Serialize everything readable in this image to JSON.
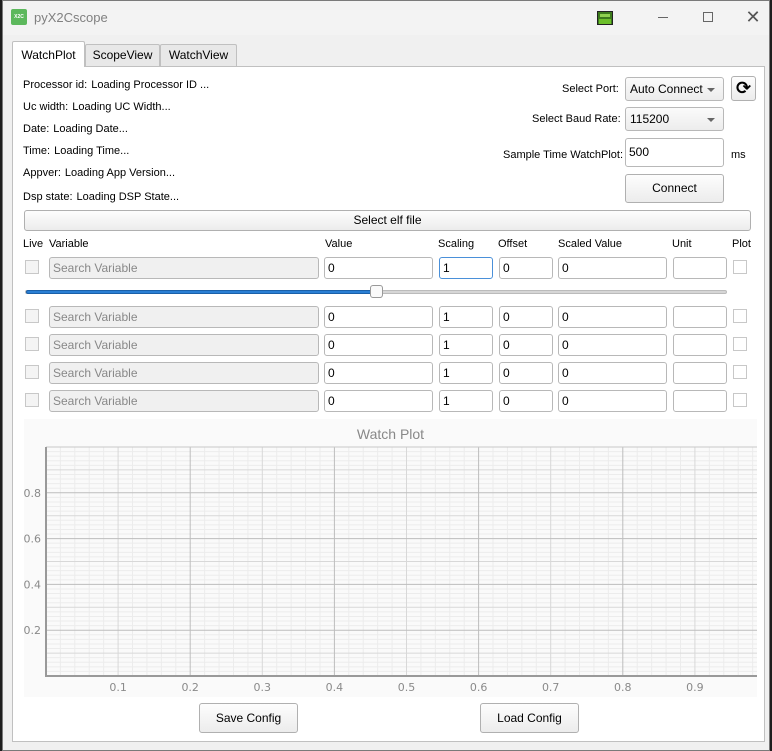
{
  "window": {
    "title": "pyX2Cscope",
    "app_icon": "x2c-icon",
    "tray_icon": "x2c-board-icon",
    "controls": [
      "minimize-icon",
      "maximize-icon",
      "close-icon"
    ],
    "close_glyph": "✕"
  },
  "tabs": [
    {
      "label": "WatchPlot",
      "active": true
    },
    {
      "label": "ScopeView",
      "active": false
    },
    {
      "label": "WatchView",
      "active": false
    }
  ],
  "device_info": [
    {
      "key": "Processor id:",
      "value": "Loading Processor ID ..."
    },
    {
      "key": "Uc width:",
      "value": "Loading UC Width..."
    },
    {
      "key": "Date:",
      "value": "Loading Date..."
    },
    {
      "key": "Time:",
      "value": "Loading Time..."
    },
    {
      "key": "Appver:",
      "value": "Loading App Version..."
    },
    {
      "key": "Dsp state:",
      "value": "Loading DSP State..."
    }
  ],
  "connection": {
    "port_label": "Select Port:",
    "port_value": "Auto Connect",
    "refresh_icon": "refresh-icon",
    "refresh_glyph": "⟳",
    "baud_label": "Select Baud Rate:",
    "baud_value": "115200",
    "sample_label": "Sample Time WatchPlot:",
    "sample_value": "500",
    "sample_unit": "ms",
    "connect_label": "Connect"
  },
  "select_elf_label": "Select elf file",
  "table": {
    "headers": {
      "live": "Live",
      "variable": "Variable",
      "value": "Value",
      "scaling": "Scaling",
      "offset": "Offset",
      "scaled_value": "Scaled Value",
      "unit": "Unit",
      "plot": "Plot"
    },
    "rows": [
      {
        "variable_placeholder": "Search Variable",
        "value": "0",
        "scaling": "1",
        "offset": "0",
        "scaled_value": "0",
        "unit": ""
      },
      {
        "variable_placeholder": "Search Variable",
        "value": "0",
        "scaling": "1",
        "offset": "0",
        "scaled_value": "0",
        "unit": ""
      },
      {
        "variable_placeholder": "Search Variable",
        "value": "0",
        "scaling": "1",
        "offset": "0",
        "scaled_value": "0",
        "unit": ""
      },
      {
        "variable_placeholder": "Search Variable",
        "value": "0",
        "scaling": "1",
        "offset": "0",
        "scaled_value": "0",
        "unit": ""
      },
      {
        "variable_placeholder": "Search Variable",
        "value": "0",
        "scaling": "1",
        "offset": "0",
        "scaled_value": "0",
        "unit": ""
      }
    ],
    "slider_value_fraction": 0.5
  },
  "chart_data": {
    "type": "line",
    "title": "Watch Plot",
    "xlabel": "",
    "ylabel": "",
    "xlim": [
      0,
      1
    ],
    "ylim": [
      0,
      1
    ],
    "x_ticks": [
      0.1,
      0.2,
      0.3,
      0.4,
      0.5,
      0.6,
      0.7,
      0.8,
      0.9
    ],
    "y_ticks": [
      0.2,
      0.4,
      0.6,
      0.8
    ],
    "grid": true,
    "series": []
  },
  "footer": {
    "save_label": "Save Config",
    "load_label": "Load Config"
  }
}
